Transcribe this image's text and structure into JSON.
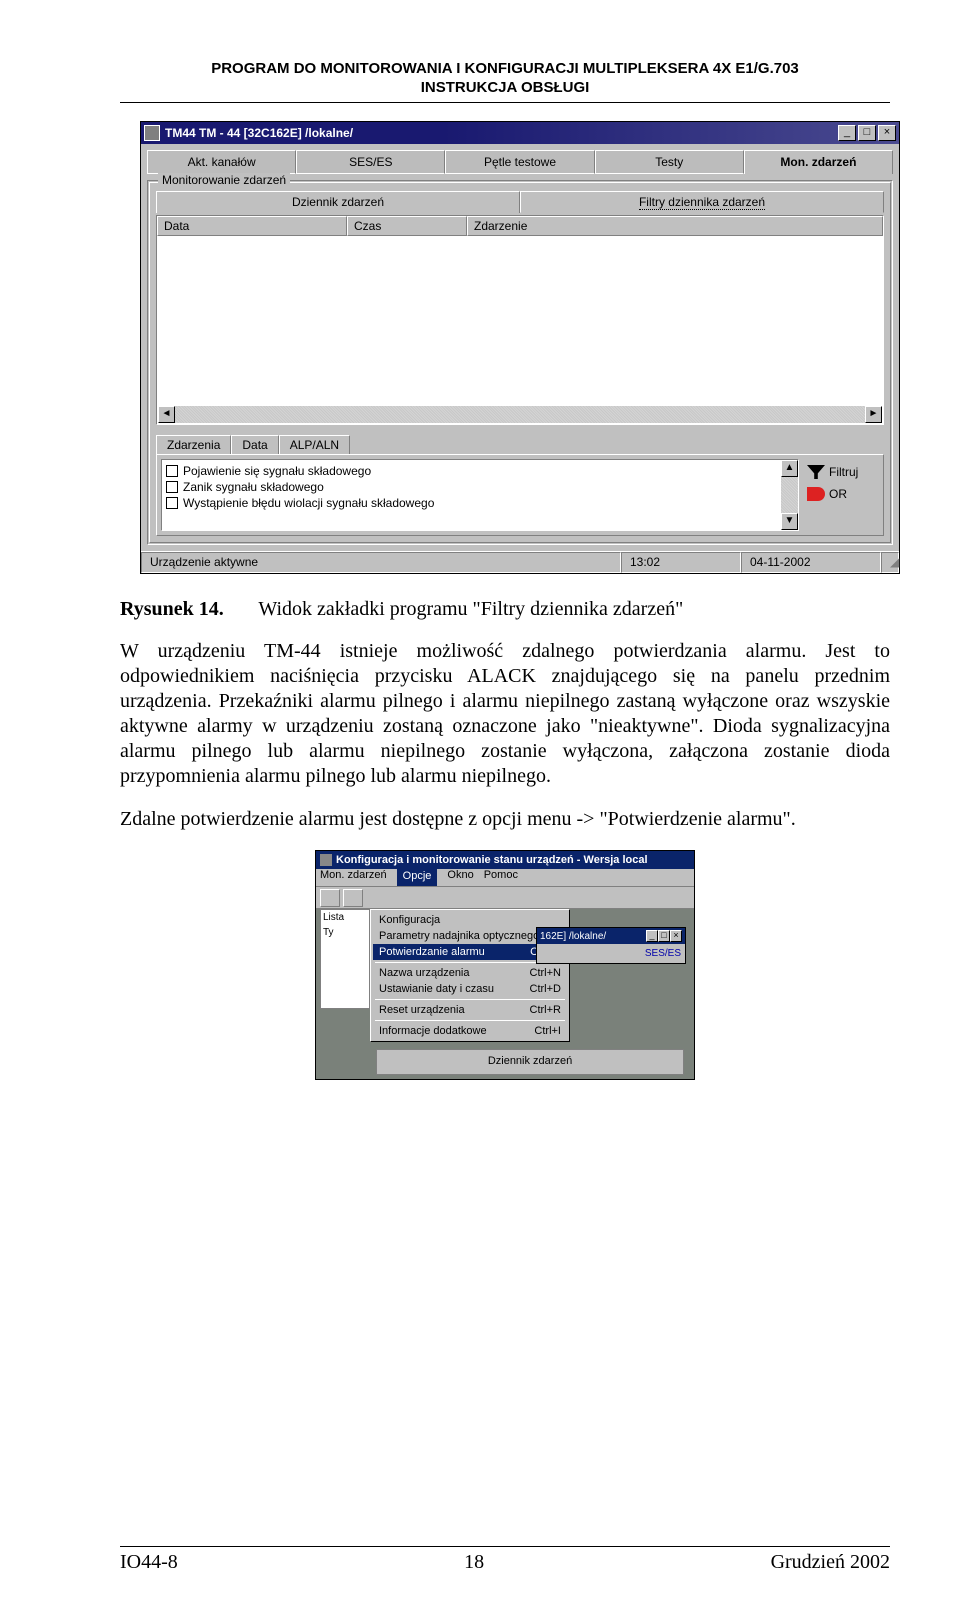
{
  "header": {
    "line1": "PROGRAM DO MONITOROWANIA I KONFIGURACJI MULTIPLEKSERA 4X E1/G.703",
    "line2": "INSTRUKCJA OBSŁUGI"
  },
  "window": {
    "title": "TM44 TM - 44 [32C162E] /lokalne/",
    "tabs": [
      "Akt. kanałów",
      "SES/ES",
      "Pętle testowe",
      "Testy",
      "Mon. zdarzeń"
    ],
    "activeTabIndex": 4,
    "groupLabel": "Monitorowanie zdarzeń",
    "subtabs": [
      "Dziennik zdarzeń",
      "Filtry dziennika zdarzeń"
    ],
    "activeSubtabIndex": 1,
    "columns": [
      "Data",
      "Czas",
      "Zdarzenie"
    ],
    "bottomTabs": [
      "Zdarzenia",
      "Data",
      "ALP/ALN"
    ],
    "checkitems": [
      "Pojawienie się sygnału składowego",
      "Zanik sygnału składowego",
      "Wystąpienie błędu wiolacji sygnału składowego"
    ],
    "side": {
      "filter": "Filtruj",
      "or": "OR"
    },
    "status": {
      "device": "Urządzenie aktywne",
      "time": "13:02",
      "date": "04-11-2002"
    }
  },
  "caption": {
    "label": "Rysunek 14.",
    "text": "Widok zakładki programu \"Filtry dziennika zdarzeń\""
  },
  "body": {
    "p1": "W urządzeniu TM-44 istnieje możliwość zdalnego potwierdzania alarmu. Jest to odpowiednikiem naciśnięcia przycisku ALACK znajdującego się na panelu przednim urządzenia. Przekaźniki alarmu pilnego i alarmu niepilnego zastaną wyłączone oraz wszyskie aktywne alarmy w urządzeniu zostaną oznaczone jako \"nieaktywne\". Dioda sygnalizacyjna alarmu pilnego lub alarmu niepilnego zostanie wyłączona, załączona zostanie dioda przypomnienia alarmu pilnego lub alarmu niepilnego.",
    "p2": "Zdalne potwierdzenie alarmu jest dostępne z opcji menu -> \"Potwierdzenie alarmu\"."
  },
  "menushot": {
    "title": "Konfiguracja i monitorowanie stanu urządzeń  - Wersja local",
    "menubar": [
      "Mon. zdarzeń",
      "Opcje",
      "Okno",
      "Pomoc"
    ],
    "selectedMenuIndex": 1,
    "items": [
      {
        "label": "Konfiguracja",
        "accel": ""
      },
      {
        "label": "Parametry nadajnika optycznego",
        "accel": ""
      },
      {
        "label": "Potwierdzanie alarmu",
        "accel": "Ctrl+A",
        "selected": true
      },
      {
        "sep": true
      },
      {
        "label": "Nazwa urządzenia",
        "accel": "Ctrl+N"
      },
      {
        "label": "Ustawianie daty i czasu",
        "accel": "Ctrl+D"
      },
      {
        "sep": true
      },
      {
        "label": "Reset urządzenia",
        "accel": "Ctrl+R"
      },
      {
        "sep": true
      },
      {
        "label": "Informacje dodatkowe",
        "accel": "Ctrl+I"
      }
    ],
    "listLabels": [
      "Lista",
      "Ty"
    ],
    "child": {
      "title": "162E] /lokalne/",
      "tab": "SES/ES"
    },
    "bottom": "Dziennik zdarzeń"
  },
  "footer": {
    "left": "IO44-8",
    "center": "18",
    "right": "Grudzień 2002"
  }
}
